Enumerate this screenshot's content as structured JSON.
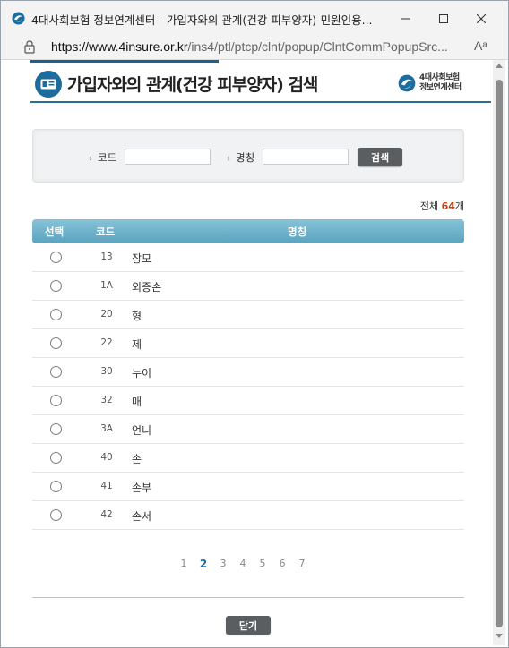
{
  "window": {
    "title": "4대사회보험 정보연계센터 - 가입자와의 관계(건강 피부양자)-민원인용...",
    "url_host": "https://www.4insure.or.kr",
    "url_path": "/ins4/ptl/ptcp/clnt/popup/ClntCommPopupSrc...",
    "read_aloud": "Aᵃ"
  },
  "header": {
    "title": "가입자와의 관계(건강 피부양자) 검색",
    "brand_line1": "4대사회보험",
    "brand_line2": "정보연계센터"
  },
  "search": {
    "code_label": "코드",
    "code_value": "",
    "name_label": "명칭",
    "name_value": "",
    "button_label": "검색"
  },
  "total": {
    "prefix": "전체",
    "count": "64",
    "suffix": "개"
  },
  "table": {
    "headers": {
      "select": "선택",
      "code": "코드",
      "name": "명칭"
    },
    "rows": [
      {
        "code": "13",
        "name": "장모"
      },
      {
        "code": "1A",
        "name": "외증손"
      },
      {
        "code": "20",
        "name": "형"
      },
      {
        "code": "22",
        "name": "제"
      },
      {
        "code": "30",
        "name": "누이"
      },
      {
        "code": "32",
        "name": "매"
      },
      {
        "code": "3A",
        "name": "언니"
      },
      {
        "code": "40",
        "name": "손"
      },
      {
        "code": "41",
        "name": "손부"
      },
      {
        "code": "42",
        "name": "손서"
      }
    ]
  },
  "pagination": {
    "pages": [
      "1",
      "2",
      "3",
      "4",
      "5",
      "6",
      "7"
    ],
    "current": "2"
  },
  "footer": {
    "close_label": "닫기"
  },
  "colors": {
    "accent": "#1e6c9c",
    "table_header": "#6fb3cc",
    "count": "#c2410c",
    "button": "#5b5e61"
  }
}
